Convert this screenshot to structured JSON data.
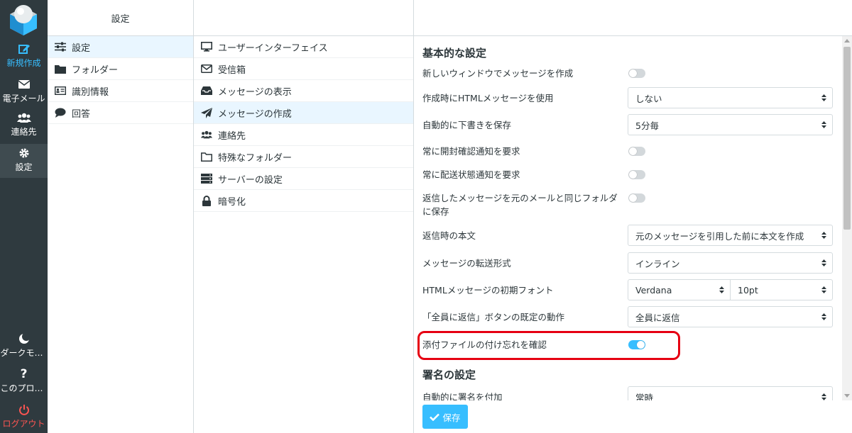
{
  "rail": {
    "compose": "新規作成",
    "mail": "電子メール",
    "contacts": "連絡先",
    "settings": "設定",
    "dark_mode": "ダークモー…",
    "about": "このプログ…",
    "logout": "ログアウト"
  },
  "col1": {
    "title": "設定",
    "items": [
      {
        "label": "設定",
        "icon": "sliders-icon"
      },
      {
        "label": "フォルダー",
        "icon": "folder-icon"
      },
      {
        "label": "識別情報",
        "icon": "id-card-icon"
      },
      {
        "label": "回答",
        "icon": "speech-bubble-icon"
      }
    ]
  },
  "col2": {
    "items": [
      {
        "label": "ユーザーインターフェイス",
        "icon": "monitor-icon"
      },
      {
        "label": "受信箱",
        "icon": "envelope-icon"
      },
      {
        "label": "メッセージの表示",
        "icon": "inbox-icon"
      },
      {
        "label": "メッセージの作成",
        "icon": "paper-plane-icon"
      },
      {
        "label": "連絡先",
        "icon": "users-icon"
      },
      {
        "label": "特殊なフォルダー",
        "icon": "folder-outline-icon"
      },
      {
        "label": "サーバーの設定",
        "icon": "server-icon"
      },
      {
        "label": "暗号化",
        "icon": "lock-icon"
      }
    ]
  },
  "main": {
    "section1": "基本的な設定",
    "rows": {
      "new_window": "新しいウィンドウでメッセージを作成",
      "html_compose": "作成時にHTMLメッセージを使用",
      "html_compose_value": "しない",
      "autosave": "自動的に下書きを保存",
      "autosave_value": "5分毎",
      "mdn": "常に開封確認通知を要求",
      "dsn": "常に配送状態通知を要求",
      "reply_same_folder": "返信したメッセージを元のメールと同じフォルダに保存",
      "reply_mode": "返信時の本文",
      "reply_mode_value": "元のメッセージを引用した前に本文を作成",
      "forward": "メッセージの転送形式",
      "forward_value": "インライン",
      "html_font": "HTMLメッセージの初期フォント",
      "html_font_value": "Verdana",
      "html_font_size": "10pt",
      "reply_all": "「全員に返信」ボタンの既定の動作",
      "reply_all_value": "全員に返信",
      "attachment_check": "添付ファイルの付け忘れを確認"
    },
    "section2": "署名の設定",
    "signature_auto": "自動的に署名を付加",
    "signature_auto_value": "常時",
    "save": "保存"
  },
  "toggles": {
    "new_window": false,
    "mdn": false,
    "dsn": false,
    "reply_same_folder": false,
    "attachment_check": true
  },
  "colors": {
    "accent": "#37beff",
    "rail_bg": "#2f3a3f",
    "logout": "#ff5552",
    "highlight": "#e60012"
  }
}
